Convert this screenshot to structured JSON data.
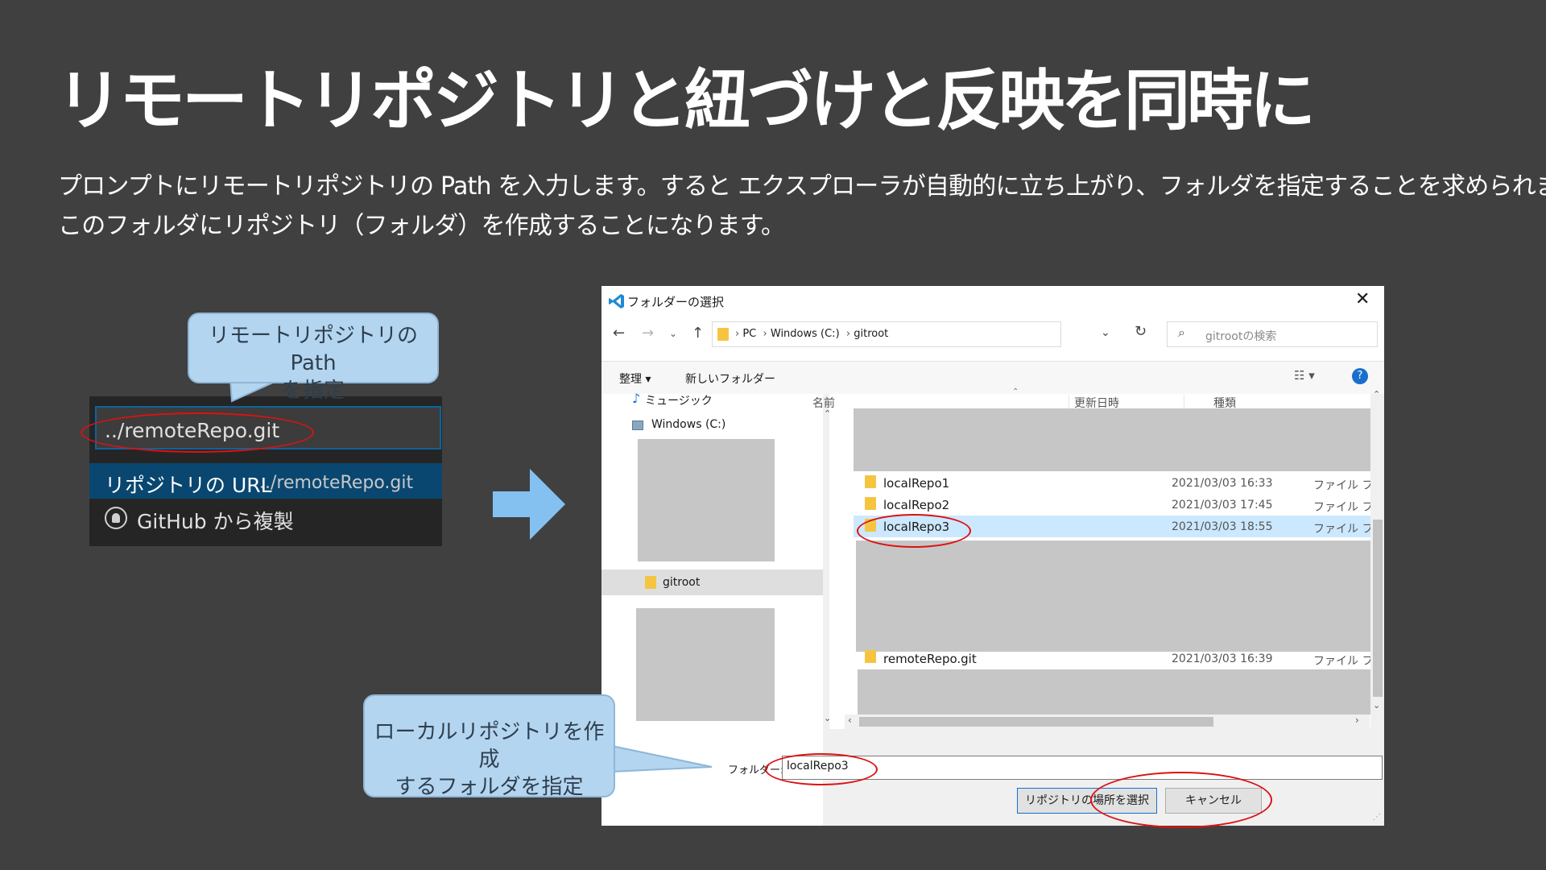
{
  "slide": {
    "title": "リモートリポジトリと紐づけと反映を同時に",
    "description_line1": "プロンプトにリモートリポジトリの Path を入力します。すると エクスプローラが自動的に立ち上がり、フォルダを指定することを求められます。",
    "description_line2": "このフォルダにリポジトリ（フォルダ）を作成することになります。"
  },
  "callouts": {
    "top_line1": "リモートリポジトリの Path",
    "top_line2": "を指定",
    "bottom_line1": "ローカルリポジトリを作成",
    "bottom_line2": "するフォルダを指定"
  },
  "vscode": {
    "input_value": "../remoteRepo.git",
    "option1_label": "リポジトリの URL",
    "option1_path": "../remoteRepo.git",
    "option2_label": "GitHub から複製"
  },
  "dialog": {
    "title": "フォルダーの選択",
    "breadcrumb": [
      "PC",
      "Windows (C:)",
      "gitroot"
    ],
    "search_placeholder": "gitrootの検索",
    "organize_label": "整理 ▾",
    "new_folder_label": "新しいフォルダー",
    "nav_items": {
      "music": "ミュージック",
      "windows_c": "Windows (C:)",
      "gitroot": "gitroot"
    },
    "columns": {
      "name": "名前",
      "modified": "更新日時",
      "type": "種類"
    },
    "files": [
      {
        "name": "localRepo1",
        "date": "2021/03/03 16:33",
        "type": "ファイル フォルダー"
      },
      {
        "name": "localRepo2",
        "date": "2021/03/03 17:45",
        "type": "ファイル フォルダー"
      },
      {
        "name": "localRepo3",
        "date": "2021/03/03 18:55",
        "type": "ファイル フォルダー"
      },
      {
        "name": "remoteRepo.git",
        "date": "2021/03/03 16:39",
        "type": "ファイル フォルダー"
      }
    ],
    "folder_label": "フォルダー:",
    "folder_value": "localRepo3",
    "select_button": "リポジトリの場所を選択",
    "cancel_button": "キャンセル",
    "accent_color": "#cce8ff"
  },
  "icons": [
    "vscode-logo-icon",
    "close-icon",
    "back-arrow-icon",
    "forward-arrow-icon",
    "up-arrow-icon",
    "refresh-icon",
    "search-icon",
    "music-note-icon",
    "drive-icon",
    "folder-icon",
    "help-icon",
    "github-icon",
    "right-arrow-icon"
  ]
}
